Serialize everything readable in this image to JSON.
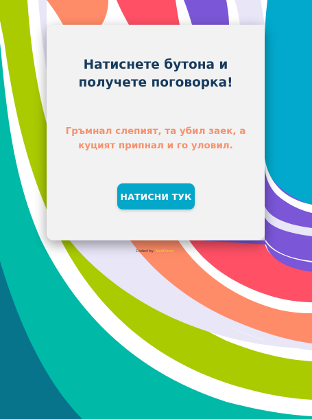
{
  "card": {
    "title": "Натиснете бутона и получете поговорка!",
    "quote": "Гръмнал слепият, та убил заек, а куцият припнал и го уловил.",
    "button_label": "НАТИСНИ ТУК"
  },
  "footer": {
    "coded_by_label": "Coded by",
    "author": "NedDinev"
  },
  "colors": {
    "title": "#163a5c",
    "quote": "#f7916c",
    "button": "#02a7c9",
    "card": "#f2f2f2",
    "wave_stripes": [
      "#08788f",
      "#00b8a8",
      "#a7cc00",
      "#e8e6f8",
      "#ff8c69",
      "#ff5064",
      "#7b55d6",
      "#00acd0"
    ]
  }
}
